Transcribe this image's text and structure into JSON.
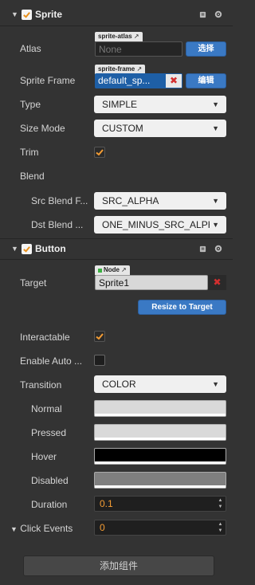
{
  "sprite_component": {
    "title": "Sprite",
    "atlas": {
      "label": "Atlas",
      "tag": "sprite-atlas",
      "value": "None",
      "button": "选择"
    },
    "sprite_frame": {
      "label": "Sprite Frame",
      "tag": "sprite-frame",
      "value": "default_sp...",
      "button": "编辑"
    },
    "type": {
      "label": "Type",
      "value": "SIMPLE"
    },
    "size_mode": {
      "label": "Size Mode",
      "value": "CUSTOM"
    },
    "trim": {
      "label": "Trim",
      "checked": true
    },
    "blend": {
      "label": "Blend"
    },
    "src_blend": {
      "label": "Src Blend F...",
      "value": "SRC_ALPHA"
    },
    "dst_blend": {
      "label": "Dst Blend ...",
      "value": "ONE_MINUS_SRC_ALPH"
    }
  },
  "button_component": {
    "title": "Button",
    "target": {
      "label": "Target",
      "tag": "Node",
      "value": "Sprite1",
      "resize_button": "Resize to Target"
    },
    "interactable": {
      "label": "Interactable",
      "checked": true
    },
    "enable_auto": {
      "label": "Enable Auto ...",
      "checked": false
    },
    "transition": {
      "label": "Transition",
      "value": "COLOR"
    },
    "normal": {
      "label": "Normal",
      "color": "#d9d9d9"
    },
    "pressed": {
      "label": "Pressed",
      "color": "#d9d9d9"
    },
    "hover": {
      "label": "Hover",
      "color": "#000000"
    },
    "disabled": {
      "label": "Disabled",
      "color": "#7f7f7f"
    },
    "duration": {
      "label": "Duration",
      "value": "0.1"
    },
    "click_events": {
      "label": "Click Events",
      "value": "0"
    }
  },
  "add_component_label": "添加组件",
  "colors": {
    "panel_bg": "#333333",
    "accent_orange": "#f39c34",
    "button_blue": "#3a79c4"
  }
}
